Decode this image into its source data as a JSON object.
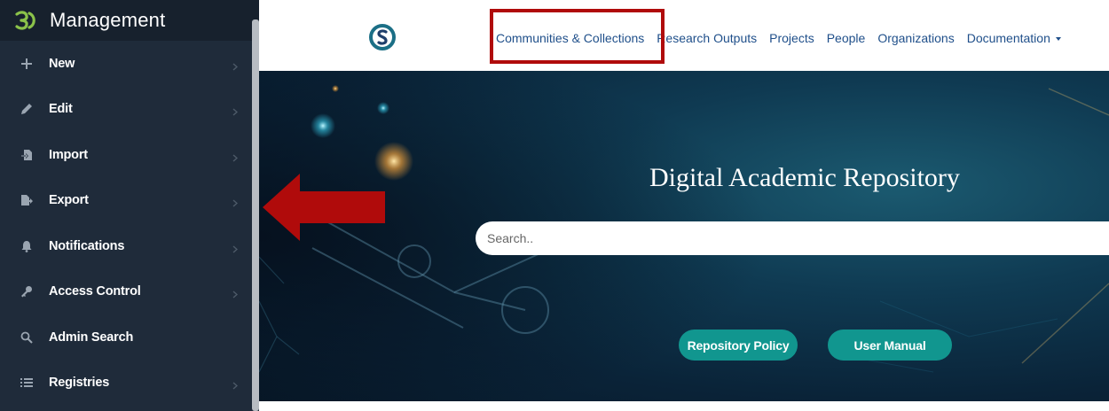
{
  "sidebar": {
    "title": "Management",
    "items": [
      {
        "label": "New",
        "icon": "plus-icon"
      },
      {
        "label": "Edit",
        "icon": "pencil-icon"
      },
      {
        "label": "Import",
        "icon": "import-icon"
      },
      {
        "label": "Export",
        "icon": "export-icon"
      },
      {
        "label": "Notifications",
        "icon": "bell-icon"
      },
      {
        "label": "Access Control",
        "icon": "key-icon"
      },
      {
        "label": "Admin Search",
        "icon": "search-icon"
      },
      {
        "label": "Registries",
        "icon": "list-icon"
      }
    ]
  },
  "nav": {
    "items": [
      "Communities & Collections",
      "Research Outputs",
      "Projects",
      "People",
      "Organizations",
      "Documentation"
    ]
  },
  "hero": {
    "title": "Digital Academic Repository",
    "search_placeholder": "Search..",
    "buttons": [
      "Repository Policy",
      "User Manual"
    ]
  },
  "colors": {
    "sidebar_bg": "#1f2b3a",
    "sidebar_header_bg": "#17212d",
    "nav_link": "#1f4f8a",
    "button_teal": "#11968f",
    "highlight_red": "#b00b0b",
    "logo_green": "#8bc34a"
  }
}
